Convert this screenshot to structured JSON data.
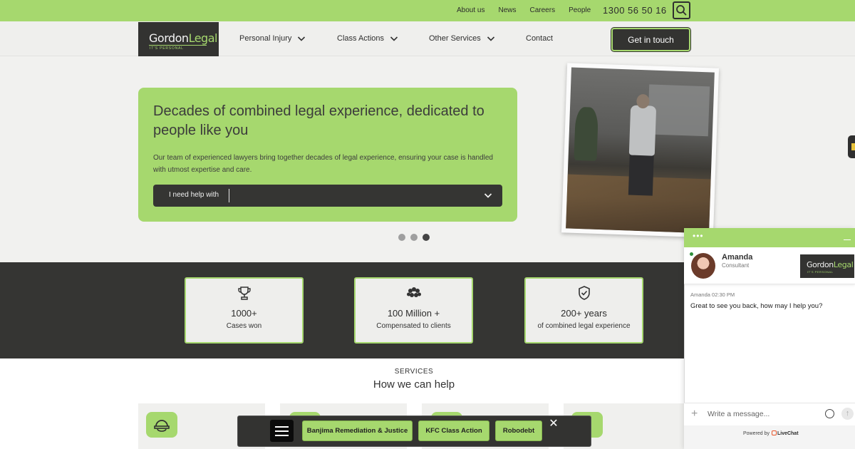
{
  "topbar": {
    "links": [
      "About us",
      "News",
      "Careers",
      "People"
    ],
    "phone": "1300 56 50 16"
  },
  "logo": {
    "brand_a": "Gordon",
    "brand_b": "Legal",
    "tagline": "IT'S PERSONAL"
  },
  "nav": {
    "items": [
      {
        "label": "Personal Injury",
        "has_dropdown": true
      },
      {
        "label": "Class Actions",
        "has_dropdown": true
      },
      {
        "label": "Other Services",
        "has_dropdown": true
      },
      {
        "label": "Contact",
        "has_dropdown": false
      }
    ],
    "cta_label": "Get in touch"
  },
  "hero": {
    "title": "Decades of combined legal experience, dedicated to people like you",
    "description": "Our team of experienced lawyers bring together decades of legal experience, ensuring your case is handled with utmost expertise and care.",
    "select_label": "I need help with",
    "carousel_active": 3,
    "carousel_count": 3
  },
  "stats": [
    {
      "icon": "trophy-icon",
      "value": "1000+",
      "label": "Cases won"
    },
    {
      "icon": "people-group-icon",
      "value": "100 Million +",
      "label": "Compensated to clients"
    },
    {
      "icon": "shield-check-icon",
      "value": "200+ years",
      "label": "of combined legal experience"
    }
  ],
  "services": {
    "kicker": "SERVICES",
    "title": "How we can help"
  },
  "quickbar": {
    "pills": [
      "Banjima Remediation & Justice",
      "KFC Class Action",
      "Robodebt"
    ]
  },
  "chat": {
    "agent_name": "Amanda",
    "agent_role": "Consultant",
    "message_meta": "Amanda 02:30 PM",
    "message": "Great to see you back, how may I help you?",
    "input_placeholder": "Write a message...",
    "powered_prefix": "Powered by",
    "powered_brand": "LiveChat"
  },
  "colors": {
    "accent": "#a6d86e",
    "dark": "#333331",
    "background": "#f1f1ef"
  }
}
